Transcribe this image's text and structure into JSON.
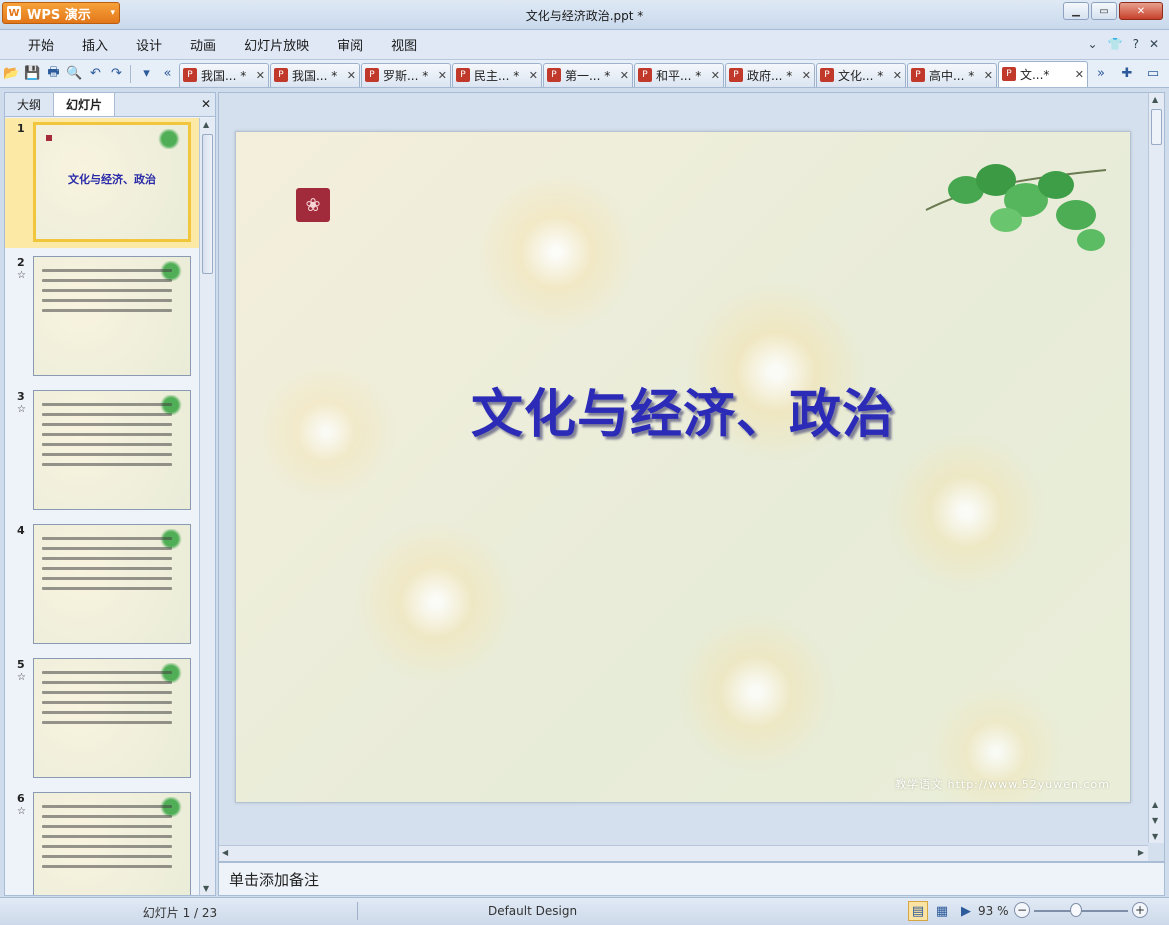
{
  "app": {
    "logo_text": "WPS 演示",
    "window_title": "文化与经济政治.ppt *"
  },
  "window_controls": {
    "minimize": "▁",
    "restore": "▭",
    "close": "✕"
  },
  "menu": {
    "items": [
      "开始",
      "插入",
      "设计",
      "动画",
      "幻灯片放映",
      "审阅",
      "视图"
    ]
  },
  "doc_tabs": [
    {
      "label": "我国... *",
      "active": false
    },
    {
      "label": "我国... *",
      "active": false
    },
    {
      "label": "罗斯... *",
      "active": false
    },
    {
      "label": "民主... *",
      "active": false
    },
    {
      "label": "第一... *",
      "active": false
    },
    {
      "label": "和平... *",
      "active": false
    },
    {
      "label": "政府... *",
      "active": false
    },
    {
      "label": "文化... *",
      "active": false
    },
    {
      "label": "高中... *",
      "active": false
    },
    {
      "label": "文...*",
      "active": true
    }
  ],
  "left_panel": {
    "tabs": [
      "大纲",
      "幻灯片"
    ],
    "active_tab": "幻灯片",
    "close": "✕",
    "thumbnails": [
      {
        "number": "1",
        "star": "",
        "title": "文化与经济、政治",
        "selected": true
      },
      {
        "number": "2",
        "star": "☆"
      },
      {
        "number": "3",
        "star": "☆"
      },
      {
        "number": "4",
        "star": ""
      },
      {
        "number": "5",
        "star": "☆"
      },
      {
        "number": "6",
        "star": "☆"
      }
    ]
  },
  "slide": {
    "title": "文化与经济、政治",
    "watermark": "教学语文 http://www.52yuwen.com"
  },
  "notes": {
    "placeholder": "单击添加备注"
  },
  "statusbar": {
    "slide_indicator": "幻灯片 1 / 23",
    "design": "Default Design",
    "zoom": "93 %",
    "zoom_level": 0.93
  },
  "colors": {
    "title": "#2b2bb8",
    "accent_orange": "#e2771a",
    "selection": "#f1c63c"
  }
}
